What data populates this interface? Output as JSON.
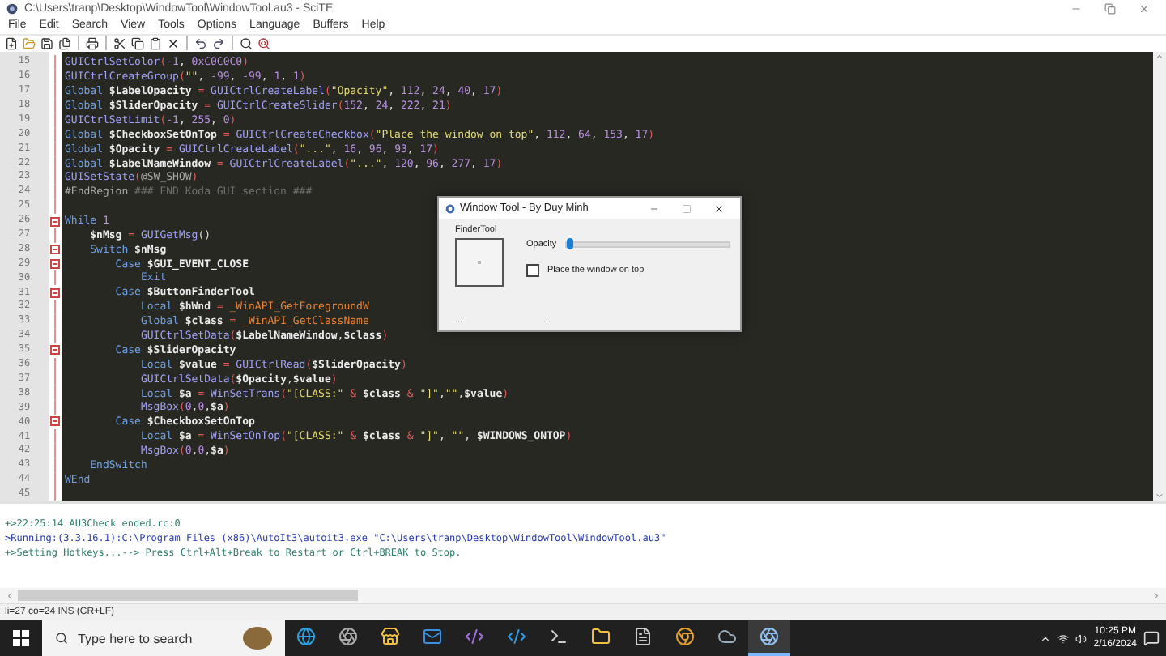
{
  "window": {
    "title": "C:\\Users\\tranp\\Desktop\\WindowTool\\WindowTool.au3 - SciTE"
  },
  "menu": [
    "File",
    "Edit",
    "Search",
    "View",
    "Tools",
    "Options",
    "Language",
    "Buffers",
    "Help"
  ],
  "editor": {
    "lines": [
      {
        "n": "15",
        "fold": false,
        "tokens": [
          {
            "kind": "fn",
            "text": "GUICtrlSetColor"
          },
          {
            "kind": "p",
            "text": "("
          },
          {
            "kind": "num",
            "text": "-1"
          },
          {
            "kind": "o",
            "text": ", "
          },
          {
            "kind": "num",
            "text": "0xC0C0C0"
          },
          {
            "kind": "p",
            "text": ")"
          }
        ]
      },
      {
        "n": "16",
        "fold": false,
        "tokens": [
          {
            "kind": "fn",
            "text": "GUICtrlCreateGroup"
          },
          {
            "kind": "p",
            "text": "("
          },
          {
            "kind": "str",
            "text": "\"\""
          },
          {
            "kind": "o",
            "text": ", "
          },
          {
            "kind": "num",
            "text": "-99"
          },
          {
            "kind": "o",
            "text": ", "
          },
          {
            "kind": "num",
            "text": "-99"
          },
          {
            "kind": "o",
            "text": ", "
          },
          {
            "kind": "num",
            "text": "1"
          },
          {
            "kind": "o",
            "text": ", "
          },
          {
            "kind": "num",
            "text": "1"
          },
          {
            "kind": "p",
            "text": ")"
          }
        ]
      },
      {
        "n": "17",
        "fold": false,
        "tokens": [
          {
            "kind": "kw",
            "text": "Global "
          },
          {
            "kind": "var",
            "text": "$LabelOpacity"
          },
          {
            "kind": "p",
            "text": " = "
          },
          {
            "kind": "fn",
            "text": "GUICtrlCreateLabel"
          },
          {
            "kind": "p",
            "text": "("
          },
          {
            "kind": "str",
            "text": "\"Opacity\""
          },
          {
            "kind": "o",
            "text": ", "
          },
          {
            "kind": "num",
            "text": "112"
          },
          {
            "kind": "o",
            "text": ", "
          },
          {
            "kind": "num",
            "text": "24"
          },
          {
            "kind": "o",
            "text": ", "
          },
          {
            "kind": "num",
            "text": "40"
          },
          {
            "kind": "o",
            "text": ", "
          },
          {
            "kind": "num",
            "text": "17"
          },
          {
            "kind": "p",
            "text": ")"
          }
        ]
      },
      {
        "n": "18",
        "fold": false,
        "tokens": [
          {
            "kind": "kw",
            "text": "Global "
          },
          {
            "kind": "var",
            "text": "$SliderOpacity"
          },
          {
            "kind": "p",
            "text": " = "
          },
          {
            "kind": "fn",
            "text": "GUICtrlCreateSlider"
          },
          {
            "kind": "p",
            "text": "("
          },
          {
            "kind": "num",
            "text": "152"
          },
          {
            "kind": "o",
            "text": ", "
          },
          {
            "kind": "num",
            "text": "24"
          },
          {
            "kind": "o",
            "text": ", "
          },
          {
            "kind": "num",
            "text": "222"
          },
          {
            "kind": "o",
            "text": ", "
          },
          {
            "kind": "num",
            "text": "21"
          },
          {
            "kind": "p",
            "text": ")"
          }
        ]
      },
      {
        "n": "19",
        "fold": false,
        "tokens": [
          {
            "kind": "fn",
            "text": "GUICtrlSetLimit"
          },
          {
            "kind": "p",
            "text": "("
          },
          {
            "kind": "num",
            "text": "-1"
          },
          {
            "kind": "o",
            "text": ", "
          },
          {
            "kind": "num",
            "text": "255"
          },
          {
            "kind": "o",
            "text": ", "
          },
          {
            "kind": "num",
            "text": "0"
          },
          {
            "kind": "p",
            "text": ")"
          }
        ]
      },
      {
        "n": "20",
        "fold": false,
        "tokens": [
          {
            "kind": "kw",
            "text": "Global "
          },
          {
            "kind": "var",
            "text": "$CheckboxSetOnTop"
          },
          {
            "kind": "p",
            "text": " = "
          },
          {
            "kind": "fn",
            "text": "GUICtrlCreateCheckbox"
          },
          {
            "kind": "p",
            "text": "("
          },
          {
            "kind": "str",
            "text": "\"Place the window on top\""
          },
          {
            "kind": "o",
            "text": ", "
          },
          {
            "kind": "num",
            "text": "112"
          },
          {
            "kind": "o",
            "text": ", "
          },
          {
            "kind": "num",
            "text": "64"
          },
          {
            "kind": "o",
            "text": ", "
          },
          {
            "kind": "num",
            "text": "153"
          },
          {
            "kind": "o",
            "text": ", "
          },
          {
            "kind": "num",
            "text": "17"
          },
          {
            "kind": "p",
            "text": ")"
          }
        ]
      },
      {
        "n": "21",
        "fold": false,
        "tokens": [
          {
            "kind": "kw",
            "text": "Global "
          },
          {
            "kind": "var",
            "text": "$Opacity"
          },
          {
            "kind": "p",
            "text": " = "
          },
          {
            "kind": "fn",
            "text": "GUICtrlCreateLabel"
          },
          {
            "kind": "p",
            "text": "("
          },
          {
            "kind": "str",
            "text": "\"...\""
          },
          {
            "kind": "o",
            "text": ", "
          },
          {
            "kind": "num",
            "text": "16"
          },
          {
            "kind": "o",
            "text": ", "
          },
          {
            "kind": "num",
            "text": "96"
          },
          {
            "kind": "o",
            "text": ", "
          },
          {
            "kind": "num",
            "text": "93"
          },
          {
            "kind": "o",
            "text": ", "
          },
          {
            "kind": "num",
            "text": "17"
          },
          {
            "kind": "p",
            "text": ")"
          }
        ]
      },
      {
        "n": "22",
        "fold": false,
        "tokens": [
          {
            "kind": "kw",
            "text": "Global "
          },
          {
            "kind": "var",
            "text": "$LabelNameWindow"
          },
          {
            "kind": "p",
            "text": " = "
          },
          {
            "kind": "fn",
            "text": "GUICtrlCreateLabel"
          },
          {
            "kind": "p",
            "text": "("
          },
          {
            "kind": "str",
            "text": "\"...\""
          },
          {
            "kind": "o",
            "text": ", "
          },
          {
            "kind": "num",
            "text": "120"
          },
          {
            "kind": "o",
            "text": ", "
          },
          {
            "kind": "num",
            "text": "96"
          },
          {
            "kind": "o",
            "text": ", "
          },
          {
            "kind": "num",
            "text": "277"
          },
          {
            "kind": "o",
            "text": ", "
          },
          {
            "kind": "num",
            "text": "17"
          },
          {
            "kind": "p",
            "text": ")"
          }
        ]
      },
      {
        "n": "23",
        "fold": false,
        "tokens": [
          {
            "kind": "fn",
            "text": "GUISetState"
          },
          {
            "kind": "p",
            "text": "("
          },
          {
            "kind": "mac",
            "text": "@SW_SHOW"
          },
          {
            "kind": "p",
            "text": ")"
          }
        ]
      },
      {
        "n": "24",
        "fold": false,
        "tokens": [
          {
            "kind": "mac",
            "text": "#EndRegion "
          },
          {
            "kind": "cmt",
            "text": "### END Koda GUI section ###"
          }
        ]
      },
      {
        "n": "25",
        "fold": false
      },
      {
        "n": "26",
        "fold": true,
        "tokens": [
          {
            "kind": "kw",
            "text": "While "
          },
          {
            "kind": "num",
            "text": "1"
          }
        ],
        "children": [
          {
            "n": "27",
            "fold": false,
            "tokens": [
              {
                "kind": "var",
                "text": "$nMsg"
              },
              {
                "kind": "p",
                "text": " = "
              },
              {
                "kind": "fn",
                "text": "GUIGetMsg"
              },
              {
                "kind": "o",
                "text": "()"
              }
            ]
          },
          {
            "n": "28",
            "fold": true,
            "tokens": [
              {
                "kind": "kw",
                "text": "Switch "
              },
              {
                "kind": "var",
                "text": "$nMsg"
              }
            ],
            "children": [
              {
                "n": "29",
                "fold": true,
                "tokens": [
                  {
                    "kind": "kw",
                    "text": "Case "
                  },
                  {
                    "kind": "var",
                    "text": "$GUI_EVENT_CLOSE"
                  }
                ],
                "children": [
                  {
                    "n": "30",
                    "fold": false,
                    "tokens": [
                      {
                        "kind": "kw",
                        "text": "Exit"
                      }
                    ]
                  }
                ]
              },
              {
                "n": "31",
                "fold": true,
                "tokens": [
                  {
                    "kind": "kw",
                    "text": "Case "
                  },
                  {
                    "kind": "var",
                    "text": "$ButtonFinderTool"
                  }
                ],
                "children": [
                  {
                    "n": "32",
                    "fold": false,
                    "tokens": [
                      {
                        "kind": "kw",
                        "text": "Local "
                      },
                      {
                        "kind": "var",
                        "text": "$hWnd"
                      },
                      {
                        "kind": "p",
                        "text": " = "
                      },
                      {
                        "kind": "udf",
                        "text": "_WinAPI_GetForegroundW"
                      }
                    ]
                  },
                  {
                    "n": "33",
                    "fold": false,
                    "tokens": [
                      {
                        "kind": "kw",
                        "text": "Global "
                      },
                      {
                        "kind": "var",
                        "text": "$class"
                      },
                      {
                        "kind": "p",
                        "text": " = "
                      },
                      {
                        "kind": "udf",
                        "text": "_WinAPI_GetClassName"
                      }
                    ]
                  },
                  {
                    "n": "34",
                    "fold": false,
                    "tokens": [
                      {
                        "kind": "fn",
                        "text": "GUICtrlSetData"
                      },
                      {
                        "kind": "p",
                        "text": "("
                      },
                      {
                        "kind": "var",
                        "text": "$LabelNameWindow"
                      },
                      {
                        "kind": "o",
                        "text": ","
                      },
                      {
                        "kind": "var",
                        "text": "$class"
                      },
                      {
                        "kind": "p",
                        "text": ")"
                      }
                    ]
                  }
                ]
              },
              {
                "n": "35",
                "fold": true,
                "tokens": [
                  {
                    "kind": "kw",
                    "text": "Case "
                  },
                  {
                    "kind": "var",
                    "text": "$SliderOpacity"
                  }
                ],
                "children": [
                  {
                    "n": "36",
                    "fold": false,
                    "tokens": [
                      {
                        "kind": "kw",
                        "text": "Local "
                      },
                      {
                        "kind": "var",
                        "text": "$value"
                      },
                      {
                        "kind": "p",
                        "text": " = "
                      },
                      {
                        "kind": "fn",
                        "text": "GUICtrlRead"
                      },
                      {
                        "kind": "p",
                        "text": "("
                      },
                      {
                        "kind": "var",
                        "text": "$SliderOpacity"
                      },
                      {
                        "kind": "p",
                        "text": ")"
                      }
                    ]
                  },
                  {
                    "n": "37",
                    "fold": false,
                    "tokens": [
                      {
                        "kind": "fn",
                        "text": "GUICtrlSetData"
                      },
                      {
                        "kind": "p",
                        "text": "("
                      },
                      {
                        "kind": "var",
                        "text": "$Opacity"
                      },
                      {
                        "kind": "o",
                        "text": ","
                      },
                      {
                        "kind": "var",
                        "text": "$value"
                      },
                      {
                        "kind": "p",
                        "text": ")"
                      }
                    ]
                  },
                  {
                    "n": "38",
                    "fold": false,
                    "tokens": [
                      {
                        "kind": "kw",
                        "text": "Local "
                      },
                      {
                        "kind": "var",
                        "text": "$a"
                      },
                      {
                        "kind": "p",
                        "text": " = "
                      },
                      {
                        "kind": "fn",
                        "text": "WinSetTrans"
                      },
                      {
                        "kind": "p",
                        "text": "("
                      },
                      {
                        "kind": "str",
                        "text": "\"[CLASS:\""
                      },
                      {
                        "kind": "p",
                        "text": " & "
                      },
                      {
                        "kind": "var",
                        "text": "$class"
                      },
                      {
                        "kind": "p",
                        "text": " & "
                      },
                      {
                        "kind": "str",
                        "text": "\"]\""
                      },
                      {
                        "kind": "o",
                        "text": ","
                      },
                      {
                        "kind": "str",
                        "text": "\"\""
                      },
                      {
                        "kind": "o",
                        "text": ","
                      },
                      {
                        "kind": "var",
                        "text": "$value"
                      },
                      {
                        "kind": "p",
                        "text": ")"
                      }
                    ]
                  },
                  {
                    "n": "39",
                    "fold": false,
                    "tokens": [
                      {
                        "kind": "fn",
                        "text": "MsgBox"
                      },
                      {
                        "kind": "p",
                        "text": "("
                      },
                      {
                        "kind": "num",
                        "text": "0"
                      },
                      {
                        "kind": "o",
                        "text": ","
                      },
                      {
                        "kind": "num",
                        "text": "0"
                      },
                      {
                        "kind": "o",
                        "text": ","
                      },
                      {
                        "kind": "var",
                        "text": "$a"
                      },
                      {
                        "kind": "p",
                        "text": ")"
                      }
                    ]
                  }
                ]
              },
              {
                "n": "40",
                "fold": true,
                "tokens": [
                  {
                    "kind": "kw",
                    "text": "Case "
                  },
                  {
                    "kind": "var",
                    "text": "$CheckboxSetOnTop"
                  }
                ],
                "children": [
                  {
                    "n": "41",
                    "fold": false,
                    "tokens": [
                      {
                        "kind": "kw",
                        "text": "Local "
                      },
                      {
                        "kind": "var",
                        "text": "$a"
                      },
                      {
                        "kind": "p",
                        "text": " = "
                      },
                      {
                        "kind": "fn",
                        "text": "WinSetOnTop"
                      },
                      {
                        "kind": "p",
                        "text": "("
                      },
                      {
                        "kind": "str",
                        "text": "\"[CLASS:\""
                      },
                      {
                        "kind": "p",
                        "text": " & "
                      },
                      {
                        "kind": "var",
                        "text": "$class"
                      },
                      {
                        "kind": "p",
                        "text": " & "
                      },
                      {
                        "kind": "str",
                        "text": "\"]\""
                      },
                      {
                        "kind": "o",
                        "text": ", "
                      },
                      {
                        "kind": "str",
                        "text": "\"\""
                      },
                      {
                        "kind": "o",
                        "text": ", "
                      },
                      {
                        "kind": "var",
                        "text": "$WINDOWS_ONTOP"
                      },
                      {
                        "kind": "p",
                        "text": ")"
                      }
                    ]
                  },
                  {
                    "n": "42",
                    "fold": false,
                    "tokens": [
                      {
                        "kind": "fn",
                        "text": "MsgBox"
                      },
                      {
                        "kind": "p",
                        "text": "("
                      },
                      {
                        "kind": "num",
                        "text": "0"
                      },
                      {
                        "kind": "o",
                        "text": ","
                      },
                      {
                        "kind": "num",
                        "text": "0"
                      },
                      {
                        "kind": "o",
                        "text": ","
                      },
                      {
                        "kind": "var",
                        "text": "$a"
                      },
                      {
                        "kind": "p",
                        "text": ")"
                      }
                    ]
                  }
                ]
              }
            ]
          },
          {
            "n": "43",
            "fold": false,
            "tokens": [
              {
                "kind": "kw",
                "text": "EndSwitch"
              }
            ]
          }
        ]
      },
      {
        "n": "44",
        "fold": false,
        "tokens": [
          {
            "kind": "kw",
            "text": "WEnd"
          }
        ]
      },
      {
        "n": "45",
        "fold": false
      }
    ]
  },
  "dialog": {
    "title": "Window Tool - By Duy Minh",
    "group": "FinderTool",
    "opacity_label": "Opacity",
    "slider": {
      "level": 0.02
    },
    "checkbox": {
      "label": "Place the window on top",
      "checked": false
    },
    "labels": [
      "...",
      "..."
    ]
  },
  "output": [
    {
      "text": "+>22:25:14 AU3Check ended.rc:0",
      "color": "#2e7d6e"
    },
    {
      "text": ">Running:(3.3.16.1):C:\\Program Files (x86)\\AutoIt3\\autoit3.exe \"C:\\Users\\tranp\\Desktop\\WindowTool\\WindowTool.au3\"",
      "color": "#2a3cae"
    },
    {
      "text": "+>Setting Hotkeys...--> Press Ctrl+Alt+Break to Restart or Ctrl+BREAK to Stop.",
      "color": "#2e7d6e"
    }
  ],
  "status_bar": "li=27 co=24 INS (CR+LF)",
  "taskbar": {
    "search_placeholder": "Type here to search",
    "time": "10:25 PM",
    "date": "2/16/2024"
  }
}
